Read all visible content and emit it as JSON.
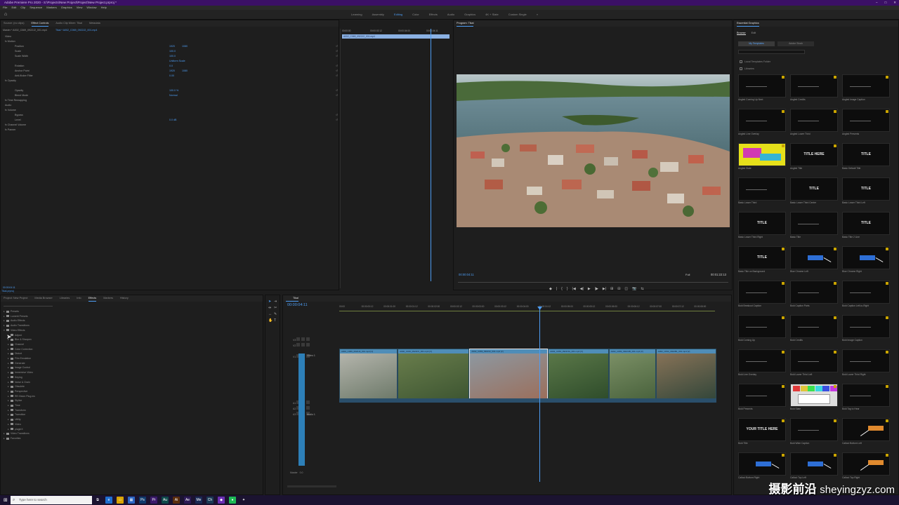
{
  "window": {
    "title": "Adobe Premiere Pro 2020 - S:\\Projects\\New Project\\Project\\New Project.prproj *"
  },
  "menu": [
    "File",
    "Edit",
    "Clip",
    "Sequence",
    "Markers",
    "Graphics",
    "View",
    "Window",
    "Help"
  ],
  "workspaces": [
    {
      "label": "Learning",
      "active": false
    },
    {
      "label": "Assembly",
      "active": false
    },
    {
      "label": "Editing",
      "active": true
    },
    {
      "label": "Color",
      "active": false
    },
    {
      "label": "Effects",
      "active": false
    },
    {
      "label": "Audio",
      "active": false
    },
    {
      "label": "Graphics",
      "active": false
    },
    {
      "label": "4K + Slate",
      "active": false
    },
    {
      "label": "Custom Single",
      "active": false
    }
  ],
  "effect_controls": {
    "tabs": [
      "Source: (no clips)",
      "Effect Controls",
      "Audio Clip Mixer: Tikal",
      "Metadata"
    ],
    "active_tab": "Effect Controls",
    "master_label": "Master * A002_C069_0922J2_001.mp4",
    "clip_label": "Tikal * A002_C069_0922J2_001.mp4",
    "rows": [
      {
        "label": "Video",
        "v1": "",
        "v2": ""
      },
      {
        "label": "fx  Motion",
        "v1": "",
        "v2": ""
      },
      {
        "label": "Position",
        "v1": "1920",
        "v2": "1080"
      },
      {
        "label": "Scale",
        "v1": "100.0",
        "v2": ""
      },
      {
        "label": "Scale Width",
        "v1": "100.0",
        "v2": ""
      },
      {
        "label": "",
        "v1": "Uniform Scale",
        "v2": ""
      },
      {
        "label": "Rotation",
        "v1": "0.0",
        "v2": ""
      },
      {
        "label": "Anchor Point",
        "v1": "1920",
        "v2": "1080"
      },
      {
        "label": "Anti-flicker Filter",
        "v1": "0.00",
        "v2": ""
      },
      {
        "label": "fx  Opacity",
        "v1": "",
        "v2": ""
      },
      {
        "label": "",
        "v1": "",
        "v2": ""
      },
      {
        "label": "Opacity",
        "v1": "100.0 %",
        "v2": ""
      },
      {
        "label": "Blend Mode",
        "v1": "Normal",
        "v2": ""
      },
      {
        "label": "fx  Time Remapping",
        "v1": "",
        "v2": ""
      },
      {
        "label": "Audio",
        "v1": "",
        "v2": ""
      },
      {
        "label": "fx  Volume",
        "v1": "",
        "v2": ""
      },
      {
        "label": "Bypass",
        "v1": "",
        "v2": ""
      },
      {
        "label": "Level",
        "v1": "0.0 dB",
        "v2": ""
      },
      {
        "label": "fx  Channel Volume",
        "v1": "",
        "v2": ""
      },
      {
        "label": "fx  Panner",
        "v1": "",
        "v2": ""
      }
    ],
    "ruler": [
      "00:00:00",
      "00:00:02:12",
      "00:00:04:00",
      "00:00:04:11"
    ],
    "clip_bar": "A002_C069_0922J2_001.mp4",
    "footer_timecode": "00:00:04:11"
  },
  "program_monitor": {
    "title": "Program: Tikal",
    "timecode": "00:00:04:11",
    "fit": "Full",
    "duration": "00:01:22:13",
    "transport": [
      "◆",
      "|",
      "{",
      "}",
      "|◀",
      "◀|",
      "▶",
      "|▶",
      "▶|",
      "⊞",
      "⊟",
      "◫",
      "📷",
      "⇆"
    ]
  },
  "essential_graphics": {
    "title": "Essential Graphics",
    "subtabs": [
      {
        "label": "Browse",
        "active": true
      },
      {
        "label": "Edit",
        "active": false
      }
    ],
    "toggle": [
      {
        "label": "My Templates",
        "active": true
      },
      {
        "label": "Adobe Stock",
        "active": false
      }
    ],
    "checks": [
      "Local Templates Folder",
      "Libraries"
    ],
    "templates": [
      {
        "name": "Angled Coming Up Next",
        "text": "",
        "style": "dark",
        "badge": true
      },
      {
        "name": "Angled Credits",
        "text": "",
        "style": "dark",
        "badge": true
      },
      {
        "name": "Angled Image Caption",
        "text": "",
        "style": "dark",
        "badge": true
      },
      {
        "name": "Angled Line Overlay",
        "text": "",
        "style": "dark",
        "badge": true
      },
      {
        "name": "Angled Lower Third",
        "text": "",
        "style": "dark",
        "badge": true
      },
      {
        "name": "Angled Presents",
        "text": "",
        "style": "dark",
        "badge": true
      },
      {
        "name": "Angled Slate",
        "text": "",
        "style": "yellow",
        "badge": true
      },
      {
        "name": "Angled Title",
        "text": "TITLE HERE",
        "style": "dark",
        "badge": true
      },
      {
        "name": "Basic Default Title",
        "text": "TITLE",
        "style": "dark",
        "badge": false
      },
      {
        "name": "Basic Lower Third",
        "text": "",
        "style": "dark",
        "badge": false
      },
      {
        "name": "Basic Lower Third Center",
        "text": "TITLE",
        "style": "dark",
        "badge": false
      },
      {
        "name": "Basic Lower Third Left",
        "text": "TITLE",
        "style": "dark",
        "badge": false
      },
      {
        "name": "Basic Lower Third Right",
        "text": "TITLE",
        "style": "dark",
        "badge": false
      },
      {
        "name": "Basic Title",
        "text": "",
        "style": "dark",
        "badge": false
      },
      {
        "name": "Basic Title 2 Line",
        "text": "TITLE",
        "style": "dark",
        "badge": false
      },
      {
        "name": "Basic Title on Background",
        "text": "TITLE",
        "style": "dark",
        "badge": true
      },
      {
        "name": "Blue Chrome Left",
        "text": "",
        "style": "blue",
        "badge": true
      },
      {
        "name": "Blue Chrome Right",
        "text": "",
        "style": "blue",
        "badge": true
      },
      {
        "name": "Bold Breakout Caption",
        "text": "",
        "style": "dark",
        "badge": true
      },
      {
        "name": "Bold Caption Parts",
        "text": "",
        "style": "dark",
        "badge": true
      },
      {
        "name": "Bold Caption Left-to-Right",
        "text": "",
        "style": "dark",
        "badge": true
      },
      {
        "name": "Bold Coming Up",
        "text": "",
        "style": "dark",
        "badge": true
      },
      {
        "name": "Bold Credits",
        "text": "",
        "style": "dark",
        "badge": true
      },
      {
        "name": "Bold Image Caption",
        "text": "",
        "style": "dark",
        "badge": true
      },
      {
        "name": "Bold Line Overlay",
        "text": "",
        "style": "dark",
        "badge": true
      },
      {
        "name": "Bold Lower Third Left",
        "text": "",
        "style": "dark",
        "badge": true
      },
      {
        "name": "Bold Lower Third Right",
        "text": "",
        "style": "dark",
        "badge": true
      },
      {
        "name": "Bold Presents",
        "text": "",
        "style": "dark",
        "badge": true
      },
      {
        "name": "Bold Slate",
        "text": "",
        "style": "slate",
        "badge": true
      },
      {
        "name": "Bold Tag to Hear",
        "text": "",
        "style": "dark",
        "badge": true
      },
      {
        "name": "Bold Title",
        "text": "YOUR TITLE HERE",
        "style": "dark",
        "badge": true
      },
      {
        "name": "Bold Wide Caption",
        "text": "",
        "style": "dark",
        "badge": true
      },
      {
        "name": "Callout Bottom Left",
        "text": "",
        "style": "orange",
        "badge": true
      },
      {
        "name": "Callout Bottom Right",
        "text": "",
        "style": "blue",
        "badge": true
      },
      {
        "name": "Callout Top Left",
        "text": "",
        "style": "blue",
        "badge": true
      },
      {
        "name": "Callout Top Right",
        "text": "",
        "style": "orange",
        "badge": true
      }
    ]
  },
  "effects_panel": {
    "tabs": [
      "Project: New Project",
      "Media Browser",
      "Libraries",
      "Info",
      "Effects",
      "Markers",
      "History"
    ],
    "active_tab": "Effects",
    "items": [
      {
        "label": "Presets",
        "level": 1
      },
      {
        "label": "Lumetri Presets",
        "level": 1
      },
      {
        "label": "Audio Effects",
        "level": 1
      },
      {
        "label": "Audio Transitions",
        "level": 1
      },
      {
        "label": "Video Effects",
        "level": 1
      },
      {
        "label": "Adjust",
        "level": 2
      },
      {
        "label": "Blur & Sharpen",
        "level": 2
      },
      {
        "label": "Channel",
        "level": 2
      },
      {
        "label": "Color Correction",
        "level": 2
      },
      {
        "label": "Distort",
        "level": 2
      },
      {
        "label": "Film Emulation",
        "level": 2
      },
      {
        "label": "Generate",
        "level": 2
      },
      {
        "label": "Image Control",
        "level": 2
      },
      {
        "label": "Immersive Video",
        "level": 2
      },
      {
        "label": "Keying",
        "level": 2
      },
      {
        "label": "Noise & Grain",
        "level": 2
      },
      {
        "label": "Obsolete",
        "level": 2
      },
      {
        "label": "Perspective",
        "level": 2
      },
      {
        "label": "RE:Vision Plug-ins",
        "level": 2
      },
      {
        "label": "Stylize",
        "level": 2
      },
      {
        "label": "Time",
        "level": 2
      },
      {
        "label": "Transform",
        "level": 2
      },
      {
        "label": "Transition",
        "level": 2
      },
      {
        "label": "Utility",
        "level": 2
      },
      {
        "label": "Video",
        "level": 2
      },
      {
        "label": "pluginX",
        "level": 2
      },
      {
        "label": "Video Transitions",
        "level": 1
      },
      {
        "label": "Favorites",
        "level": 1
      }
    ],
    "status": "Tikal.prproj"
  },
  "timeline": {
    "title": "Tikal",
    "timecode": "00:00:04:11",
    "ruler": [
      "00:00",
      "00:00:00:12",
      "00:00:01:00",
      "00:00:01:12",
      "00:00:02:00",
      "00:00:02:12",
      "00:00:03:00",
      "00:00:03:12",
      "00:00:04:00",
      "00:00:04:12",
      "00:00:05:00",
      "00:00:05:12",
      "00:00:06:00",
      "00:00:06:12",
      "00:00:07:00",
      "00:00:07:12",
      "00:00:08:00"
    ],
    "tracks": [
      "V3",
      "V2",
      "V1",
      "A1",
      "A2",
      "A3"
    ],
    "v1_label": "Video 1",
    "a1_label": "Audio 1",
    "master_label": "Master",
    "master_value": "0.0",
    "clips": [
      {
        "name": "A002_C069_0922J2_001.mp4 [V]",
        "start": 0,
        "end": 1.3,
        "colors": [
          "#b8b8b0",
          "#6e7a6a"
        ]
      },
      {
        "name": "A002_C016_0921FK_001.mp4 [V]",
        "start": 1.3,
        "end": 2.9,
        "colors": [
          "#6b7f4d",
          "#3e5632"
        ]
      },
      {
        "name": "A002_C069_0922J2_001.mp4 [V]",
        "start": 2.9,
        "end": 4.65,
        "colors": [
          "#8c9aa4",
          "#9b6f5c"
        ],
        "selected": true
      },
      {
        "name": "A002_C063_0921NG_001.mp4 [V]",
        "start": 4.65,
        "end": 6.0,
        "colors": [
          "#5d7a4a",
          "#2f4d2b"
        ]
      },
      {
        "name": "A002_C082_0922UB_001.mp4 [V]",
        "start": 6.0,
        "end": 7.05,
        "colors": [
          "#7e9268",
          "#4a633d"
        ]
      },
      {
        "name": "A002_C094_0922B1_001.mp4 [V]",
        "start": 7.05,
        "end": 8.4,
        "colors": [
          "#8c7559",
          "#34473a"
        ]
      }
    ],
    "playhead": 4.46,
    "visible_range": [
      0,
      8.4
    ]
  },
  "taskbar": {
    "search_placeholder": "Type here to search",
    "apps": [
      {
        "name": "task-view-icon",
        "glyph": "⧉",
        "color": "#1b1330"
      },
      {
        "name": "edge-icon",
        "glyph": "e",
        "color": "#1e6fd0"
      },
      {
        "name": "explorer-icon",
        "glyph": "▭",
        "color": "#d9a400"
      },
      {
        "name": "store-icon",
        "glyph": "▦",
        "color": "#2b66c4"
      },
      {
        "name": "photoshop-icon",
        "glyph": "Ps",
        "color": "#0f3a6b"
      },
      {
        "name": "premiere-icon",
        "glyph": "Pr",
        "color": "#3b1a6b"
      },
      {
        "name": "audition-icon",
        "glyph": "Au",
        "color": "#0e4a4a"
      },
      {
        "name": "illustrator-icon",
        "glyph": "Ai",
        "color": "#5a2d0c"
      },
      {
        "name": "after-effects-icon",
        "glyph": "Ae",
        "color": "#2c1a55"
      },
      {
        "name": "media-encoder-icon",
        "glyph": "Me",
        "color": "#1a2a55"
      },
      {
        "name": "character-animator-icon",
        "glyph": "Ch",
        "color": "#1a3a55"
      },
      {
        "name": "visual-studio-icon",
        "glyph": "◆",
        "color": "#6b2fb3"
      },
      {
        "name": "spotify-icon",
        "glyph": "●",
        "color": "#1db954"
      },
      {
        "name": "app-icon",
        "glyph": "✦",
        "color": "#1b1330"
      }
    ]
  },
  "watermark": {
    "cn": "摄影前沿",
    "latin": "sheyingzyz.com"
  },
  "colors": {
    "accent": "#4d9cf2",
    "titlebar": "#3b1066",
    "clip": "#4f8db8",
    "template_badge": "#c9a400"
  }
}
